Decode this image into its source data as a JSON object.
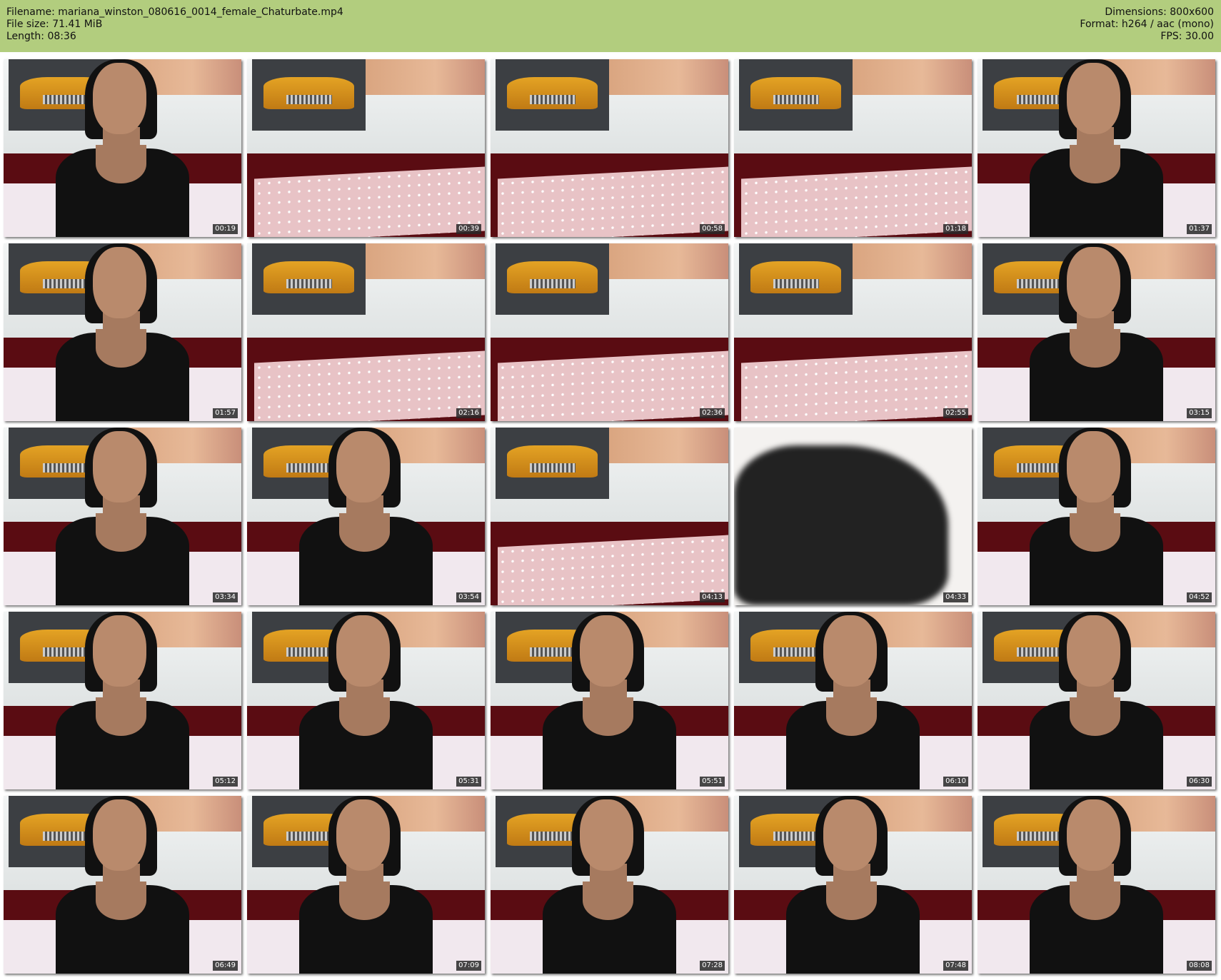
{
  "header": {
    "filename": "Filename: mariana_winston_080616_0014_female_Chaturbate.mp4",
    "filesize": "File size: 71.41 MiB",
    "length": "Length: 08:36",
    "dimensions": "Dimensions: 800x600",
    "format": "Format: h264 / aac (mono)",
    "fps": "FPS: 30.00"
  },
  "colors": {
    "header_bg": "#b2cd7e"
  },
  "thumbnails": [
    {
      "time": "00:19",
      "scene": "person"
    },
    {
      "time": "00:39",
      "scene": "room"
    },
    {
      "time": "00:58",
      "scene": "room"
    },
    {
      "time": "01:18",
      "scene": "room"
    },
    {
      "time": "01:37",
      "scene": "person"
    },
    {
      "time": "01:57",
      "scene": "person"
    },
    {
      "time": "02:16",
      "scene": "room"
    },
    {
      "time": "02:36",
      "scene": "room"
    },
    {
      "time": "02:55",
      "scene": "room"
    },
    {
      "time": "03:15",
      "scene": "person"
    },
    {
      "time": "03:34",
      "scene": "person"
    },
    {
      "time": "03:54",
      "scene": "person"
    },
    {
      "time": "04:13",
      "scene": "room"
    },
    {
      "time": "04:33",
      "scene": "blur"
    },
    {
      "time": "04:52",
      "scene": "person"
    },
    {
      "time": "05:12",
      "scene": "person"
    },
    {
      "time": "05:31",
      "scene": "person"
    },
    {
      "time": "05:51",
      "scene": "person"
    },
    {
      "time": "06:10",
      "scene": "person"
    },
    {
      "time": "06:30",
      "scene": "person"
    },
    {
      "time": "06:49",
      "scene": "person"
    },
    {
      "time": "07:09",
      "scene": "person"
    },
    {
      "time": "07:28",
      "scene": "person"
    },
    {
      "time": "07:48",
      "scene": "person"
    },
    {
      "time": "08:08",
      "scene": "person"
    }
  ]
}
